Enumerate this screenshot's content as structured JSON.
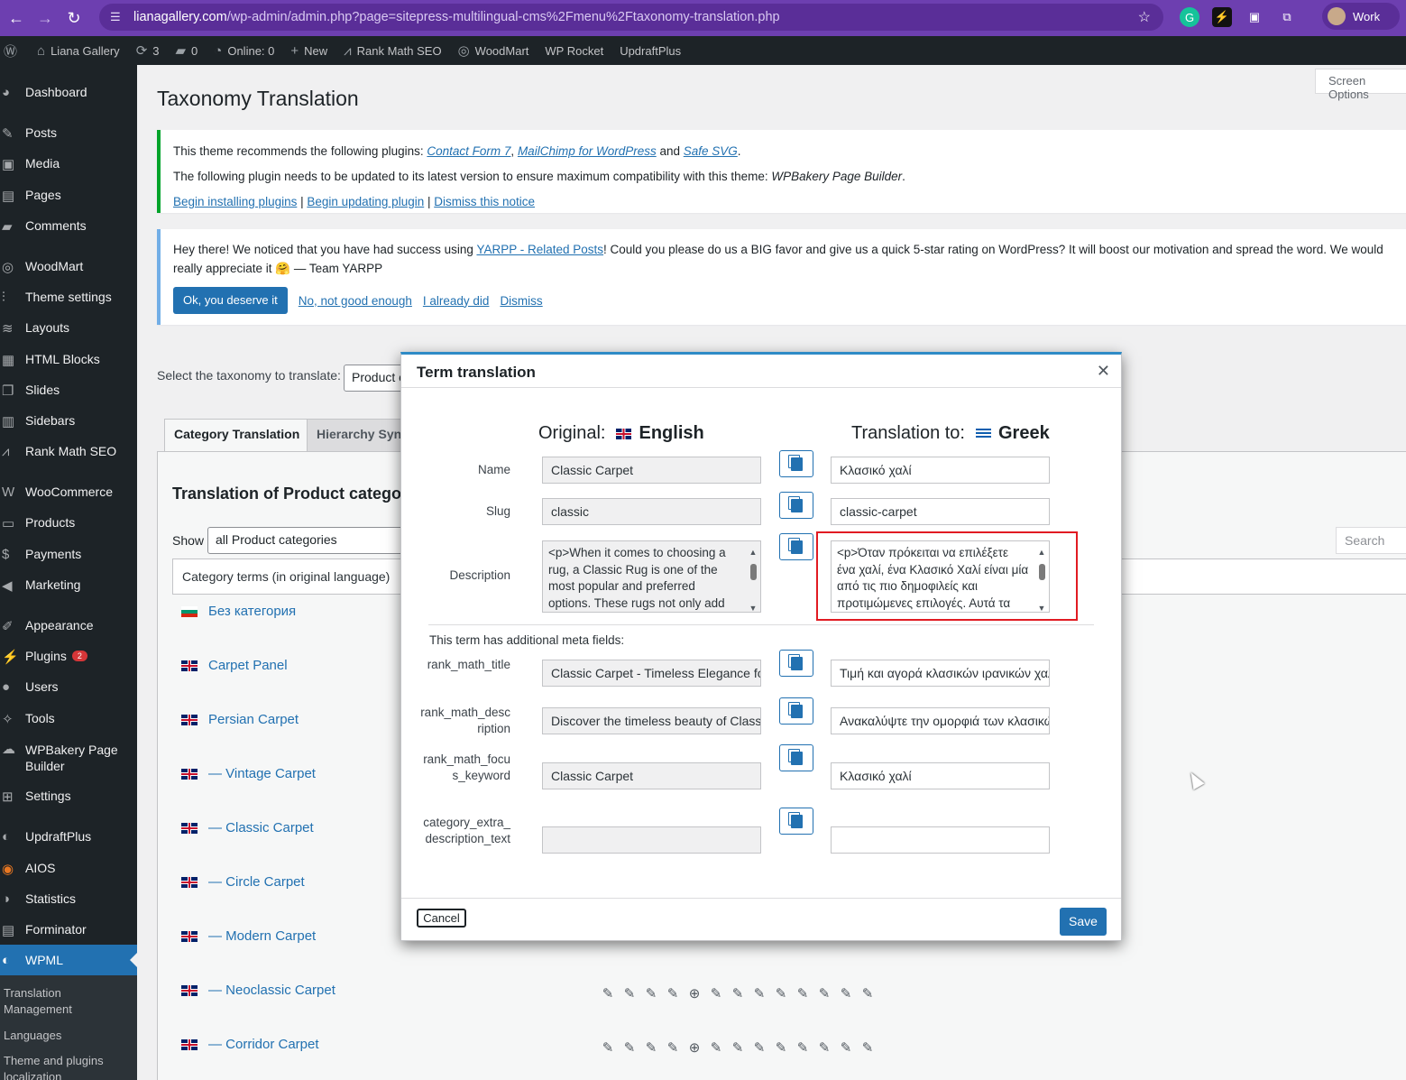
{
  "browser": {
    "url_host": "lianagallery.com",
    "url_path": "/wp-admin/admin.php?page=sitepress-multilingual-cms%2Fmenu%2Ftaxonomy-translation.php",
    "profile_label": "Work"
  },
  "adminbar": {
    "site_name": "Liana Gallery",
    "updates": "3",
    "comments": "0",
    "online": "Online: 0",
    "new": "New",
    "items": [
      "Rank Math SEO",
      "WoodMart",
      "WP Rocket",
      "UpdraftPlus"
    ]
  },
  "sidebar": {
    "items": [
      {
        "label": "Dashboard",
        "icon": "dashboard-icon"
      },
      {
        "label": "Posts",
        "icon": "pin-icon"
      },
      {
        "label": "Media",
        "icon": "media-icon"
      },
      {
        "label": "Pages",
        "icon": "pages-icon"
      },
      {
        "label": "Comments",
        "icon": "comment-icon"
      },
      {
        "label": "WoodMart",
        "icon": "woodmart-icon"
      },
      {
        "label": "Theme settings",
        "icon": "sliders-icon"
      },
      {
        "label": "Layouts",
        "icon": "layers-icon"
      },
      {
        "label": "HTML Blocks",
        "icon": "blocks-icon"
      },
      {
        "label": "Slides",
        "icon": "slides-icon"
      },
      {
        "label": "Sidebars",
        "icon": "sidebar-icon"
      },
      {
        "label": "Rank Math SEO",
        "icon": "rankmath-icon"
      },
      {
        "label": "WooCommerce",
        "icon": "woo-icon"
      },
      {
        "label": "Products",
        "icon": "archive-icon"
      },
      {
        "label": "Payments",
        "icon": "dollar-icon"
      },
      {
        "label": "Marketing",
        "icon": "megaphone-icon"
      },
      {
        "label": "Appearance",
        "icon": "brush-icon"
      },
      {
        "label": "Plugins",
        "icon": "plugin-icon",
        "badge": "2"
      },
      {
        "label": "Users",
        "icon": "user-icon"
      },
      {
        "label": "Tools",
        "icon": "wrench-icon"
      },
      {
        "label": "WPBakery Page Builder",
        "icon": "bakery-icon"
      },
      {
        "label": "Settings",
        "icon": "settings-icon"
      },
      {
        "label": "UpdraftPlus",
        "icon": "updraft-icon"
      },
      {
        "label": "AIOS",
        "icon": "shield-icon"
      },
      {
        "label": "Statistics",
        "icon": "chart-icon"
      },
      {
        "label": "Forminator",
        "icon": "form-icon"
      },
      {
        "label": "WPML",
        "icon": "wpml-icon"
      }
    ],
    "submenu": [
      "Translation Management",
      "Languages",
      "Theme and plugins localization"
    ]
  },
  "page": {
    "title": "Taxonomy Translation",
    "screen_options": "Screen Options",
    "notice1": {
      "line1_prefix": "This theme recommends the following plugins: ",
      "plugin1": "Contact Form 7",
      "plugin2": "MailChimp for WordPress",
      "and": " and ",
      "plugin3": "Safe SVG",
      "line2_prefix": "The following plugin needs to be updated to its latest version to ensure maximum compatibility with this theme: ",
      "line2_plugin": "WPBakery Page Builder",
      "link1": "Begin installing plugins",
      "link2": "Begin updating plugin",
      "link3": "Dismiss this notice"
    },
    "notice2": {
      "text_prefix": "Hey there! We noticed that you have had success using ",
      "plugin_link": "YARPP - Related Posts",
      "text_suffix": "! Could you please do us a BIG favor and give us a quick 5-star rating on WordPress? It will boost our motivation and spread the word. We would really appreciate it 🤗 — Team YARPP",
      "btn_yes": "Ok, you deserve it",
      "link_no": "No, not good enough",
      "link_did": "I already did",
      "link_dismiss": "Dismiss"
    },
    "taxonomy_label": "Select the taxonomy to translate:",
    "taxonomy_value": "Product categories",
    "tabs": [
      "Category Translation",
      "Hierarchy Synchronization"
    ],
    "panel_title": "Translation of Product categories",
    "show_label": "Show",
    "show_value": "all Product categories",
    "search_placeholder": "Search",
    "table_header": "Category terms (in original language)",
    "terms": [
      {
        "name": "Без категория",
        "flag": "bg"
      },
      {
        "name": "Carpet Panel",
        "flag": "uk"
      },
      {
        "name": "Persian Carpet",
        "flag": "uk"
      },
      {
        "name": "— Vintage Carpet",
        "flag": "uk"
      },
      {
        "name": "— Classic Carpet",
        "flag": "uk"
      },
      {
        "name": "— Circle Carpet",
        "flag": "uk"
      },
      {
        "name": "— Modern Carpet",
        "flag": "uk"
      },
      {
        "name": "— Neoclassic Carpet",
        "flag": "uk"
      },
      {
        "name": "— Corridor Carpet",
        "flag": "uk"
      }
    ]
  },
  "modal": {
    "title": "Term translation",
    "original_label": "Original:",
    "original_lang": "English",
    "translation_label": "Translation to:",
    "translation_lang": "Greek",
    "name_label": "Name",
    "name_orig": "Classic Carpet",
    "name_trans": "Κλασικό χαλί",
    "slug_label": "Slug",
    "slug_orig": "classic",
    "slug_trans": "classic-carpet",
    "desc_label": "Description",
    "desc_orig": "<p>When it comes to choosing a rug, a Classic Rug is one of the most popular and preferred options. These rugs not only add elegance and style",
    "desc_trans": "<p>Όταν πρόκειται να επιλέξετε ένα χαλί, ένα Κλασικό Χαλί είναι μία από τις πιο δημοφιλείς και προτιμώμενες επιλογές. Αυτά τα χαλιά προσθέτουν",
    "meta_note": "This term has additional meta fields:",
    "meta": [
      {
        "label": "rank_math_title",
        "orig": "Classic Carpet - Timeless Elegance for",
        "trans": "Τιμή και αγορά κλασικών ιρανικών χαλιών"
      },
      {
        "label": "rank_math_description",
        "orig": "Discover the timeless beauty of Classic",
        "trans": "Ανακαλύψτε την ομορφιά των κλασικών"
      },
      {
        "label": "rank_math_focus_keyword",
        "orig": "Classic Carpet",
        "trans": "Κλασικό χαλί"
      },
      {
        "label": "category_extra_description_text",
        "orig": "",
        "trans": ""
      }
    ],
    "cancel": "Cancel",
    "save": "Save"
  }
}
